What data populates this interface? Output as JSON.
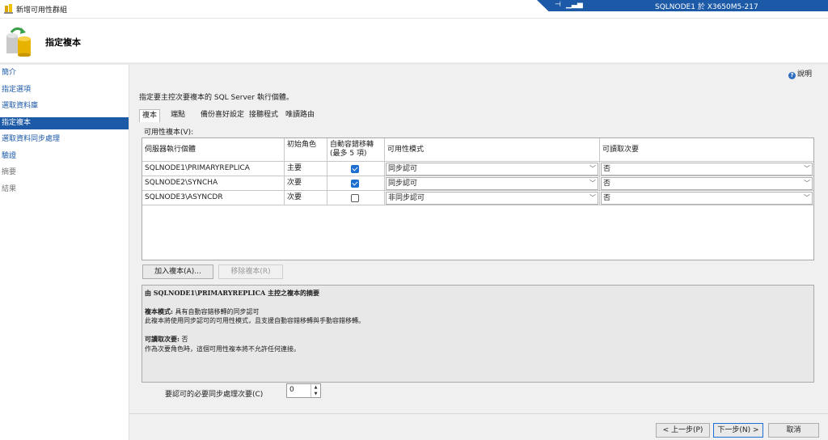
{
  "window": {
    "title": "新增可用性群組"
  },
  "remote": {
    "pin_icon": "pin-icon",
    "signal_icon": "signal-icon",
    "host": "SQLNODE1 於 X3650M5-217"
  },
  "header": {
    "title": "指定複本"
  },
  "sidebar": {
    "items": [
      {
        "label": "簡介",
        "state": "link"
      },
      {
        "label": "指定選項",
        "state": "link"
      },
      {
        "label": "選取資料庫",
        "state": "link"
      },
      {
        "label": "指定複本",
        "state": "selected"
      },
      {
        "label": "選取資料同步處理",
        "state": "link"
      },
      {
        "label": "驗證",
        "state": "link"
      },
      {
        "label": "摘要",
        "state": "disabled"
      },
      {
        "label": "結果",
        "state": "disabled"
      }
    ]
  },
  "help": {
    "label": "說明"
  },
  "instruction": "指定要主控次要複本的 SQL Server 執行個體。",
  "tabs": [
    "複本",
    "端點",
    "備份喜好設定",
    "接聽程式",
    "唯讀路由"
  ],
  "grid": {
    "label": "可用性複本(V):",
    "headers": [
      "伺服器執行個體",
      "初始角色",
      "自動容錯移轉 (最多 5 項)",
      "可用性模式",
      "可讀取次要"
    ],
    "rows": [
      {
        "server": "SQLNODE1\\PRIMARYREPLICA",
        "role": "主要",
        "auto_failover": true,
        "mode": "同步認可",
        "readable": "否"
      },
      {
        "server": "SQLNODE2\\SYNCHA",
        "role": "次要",
        "auto_failover": true,
        "mode": "同步認可",
        "readable": "否"
      },
      {
        "server": "SQLNODE3\\ASYNCDR",
        "role": "次要",
        "auto_failover": false,
        "mode": "非同步認可",
        "readable": "否"
      }
    ]
  },
  "buttons": {
    "add": "加入複本(A)...",
    "remove": "移除複本(R)"
  },
  "summary": {
    "title": "由 SQLNODE1\\PRIMARYREPLICA 主控之複本的摘要",
    "mode_label": "複本模式:",
    "mode_value": " 具有自動容錯移轉的同步認可",
    "mode_desc": "此複本將使用同步認可的可用性模式，且支援自動容錯移轉與手動容錯移轉。",
    "readable_label": "可讀取次要:",
    "readable_value": " 否",
    "readable_desc": "作為次要角色時，這個可用性複本將不允許任何連接。"
  },
  "sync_commit": {
    "label": "要認可的必要同步處理次要(C)",
    "value": "0"
  },
  "footer": {
    "prev": "< 上一步(P)",
    "next": "下一步(N) >",
    "cancel": "取消"
  }
}
